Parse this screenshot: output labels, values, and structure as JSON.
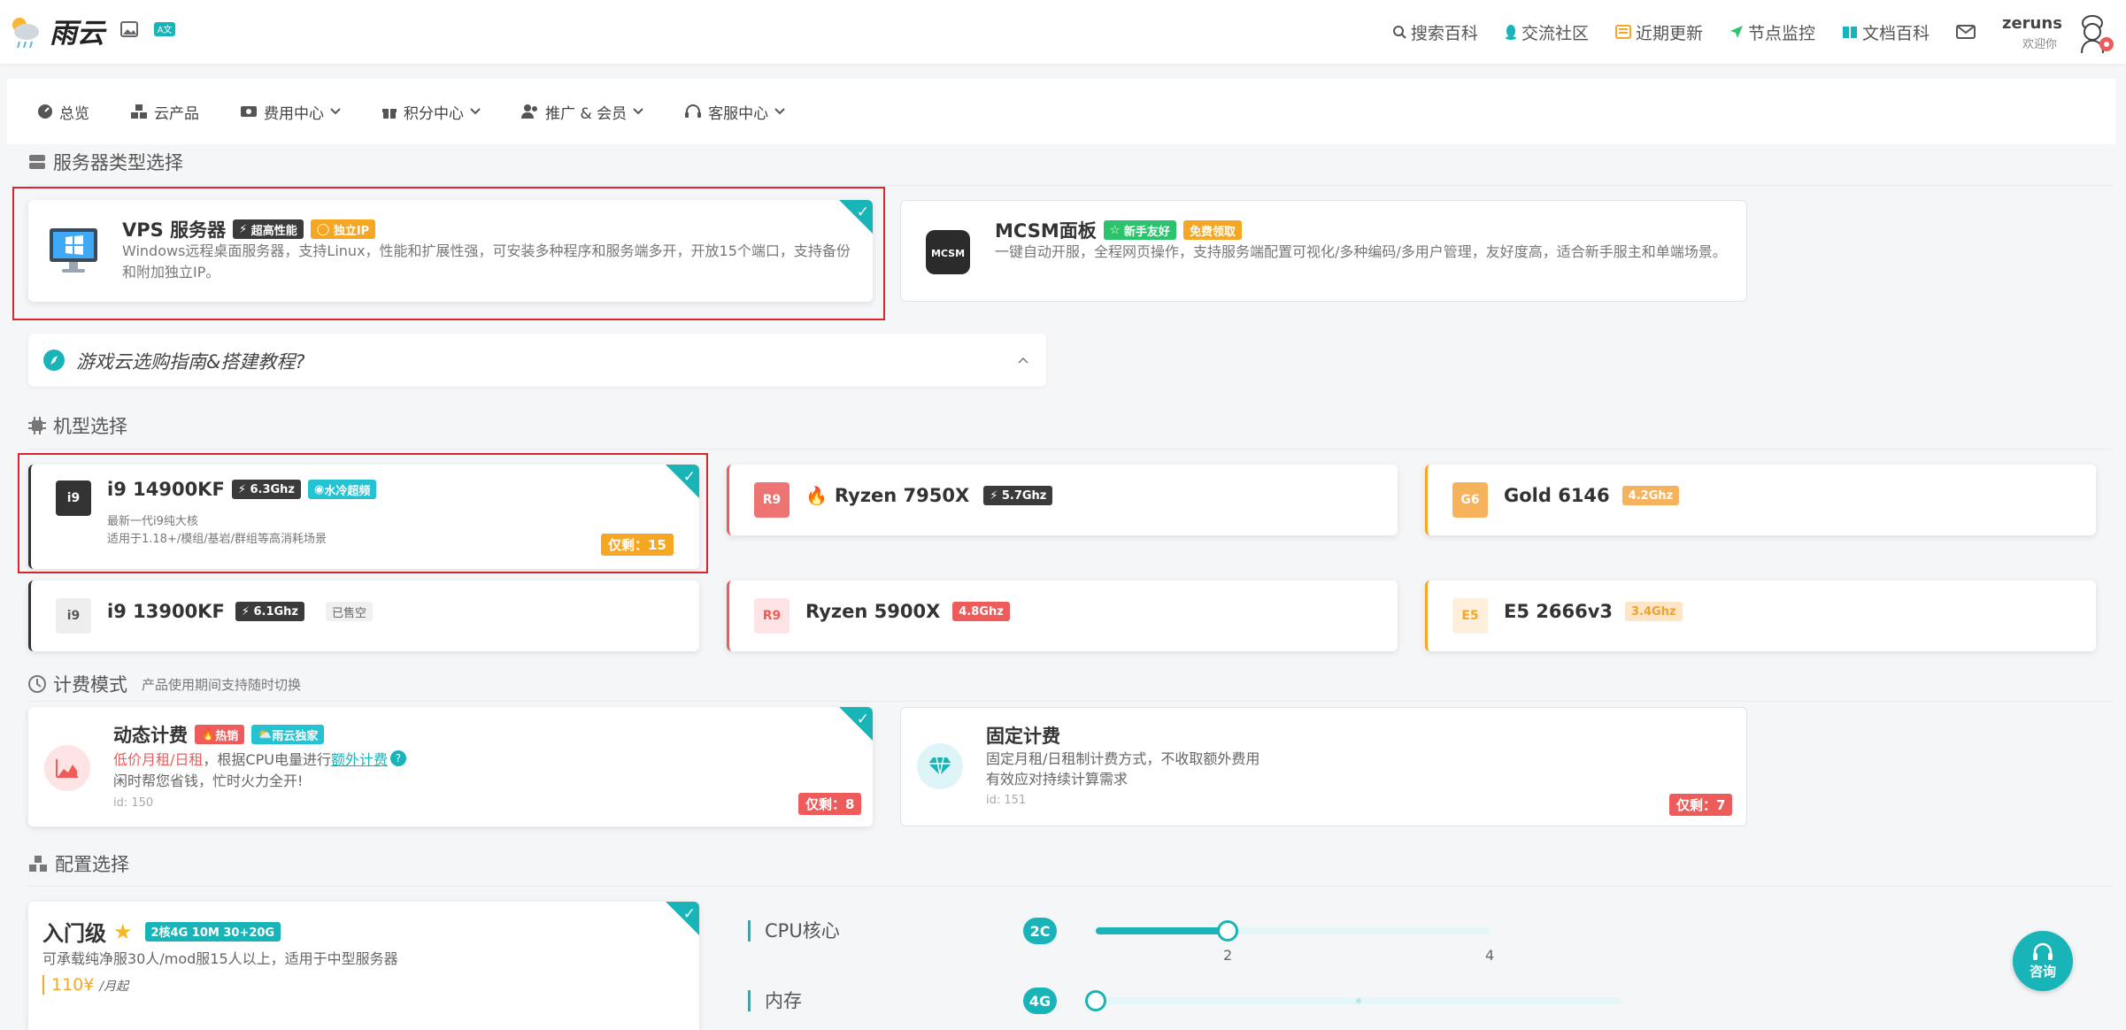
{
  "brand": {
    "name": "雨云"
  },
  "topnav": {
    "links": [
      {
        "label": "搜索百科",
        "icon": "search-icon"
      },
      {
        "label": "交流社区",
        "icon": "qq-icon"
      },
      {
        "label": "近期更新",
        "icon": "news-icon"
      },
      {
        "label": "节点监控",
        "icon": "location-arrow-icon"
      },
      {
        "label": "文档百科",
        "icon": "book-icon"
      }
    ],
    "mail_icon": "mail-icon",
    "user": {
      "name": "zeruns",
      "welcome": "欢迎你"
    }
  },
  "mainnav": {
    "items": [
      {
        "label": "总览",
        "icon": "dashboard-icon",
        "dropdown": false
      },
      {
        "label": "云产品",
        "icon": "cubes-icon",
        "dropdown": false
      },
      {
        "label": "费用中心",
        "icon": "money-icon",
        "dropdown": true
      },
      {
        "label": "积分中心",
        "icon": "gift-icon",
        "dropdown": true
      },
      {
        "label": "推广 & 会员",
        "icon": "users-icon",
        "dropdown": true
      },
      {
        "label": "客服中心",
        "icon": "headset-icon",
        "dropdown": true
      }
    ]
  },
  "server_type": {
    "section_title": "服务器类型选择",
    "options": [
      {
        "title": "VPS 服务器",
        "tags": [
          "超高性能",
          "独立IP"
        ],
        "desc": "Windows远程桌面服务器，支持Linux，性能和扩展性强，可安装多种程序和服务端多开，开放15个端口，支持备份和附加独立IP。",
        "selected": true
      },
      {
        "title": "MCSM面板",
        "tags": [
          "新手友好",
          "免费领取"
        ],
        "desc": "一键自动开服，全程网页操作，支持服务端配置可视化/多种编码/多用户管理，友好度高，适合新手服主和单端场景。",
        "selected": false
      }
    ],
    "guide": "游戏云选购指南&搭建教程?"
  },
  "machine": {
    "section_title": "机型选择",
    "options": [
      {
        "badge": "i9",
        "name": "i9 14900KF",
        "freq": "6.3Ghz",
        "extra_tag": "水冷超频",
        "line1": "最新一代i9纯大核",
        "line2": "适用于1.18+/模组/基岩/群组等高消耗场景",
        "stock": "仅剩：15",
        "selected": true
      },
      {
        "badge": "R9",
        "name": "Ryzen 7950X",
        "freq": "5.7Ghz"
      },
      {
        "badge": "G6",
        "name": "Gold 6146",
        "freq": "4.2Ghz"
      },
      {
        "badge": "i9",
        "name": "i9 13900KF",
        "freq": "6.1Ghz",
        "status": "已售空"
      },
      {
        "badge": "R9",
        "name": "Ryzen 5900X",
        "freq": "4.8Ghz"
      },
      {
        "badge": "E5",
        "name": "E5 2666v3",
        "freq": "3.4Ghz"
      }
    ]
  },
  "billing": {
    "section_title": "计费模式",
    "section_sub": "产品使用期间支持随时切换",
    "options": [
      {
        "title": "动态计费",
        "tags": [
          "热销",
          "雨云独家"
        ],
        "line1_red": "低价月租/日租",
        "line1_mid": "，根据CPU电量进行",
        "line1_link": "额外计费",
        "line2": "闲时帮您省钱，忙时火力全开!",
        "id": "id: 150",
        "stock": "仅剩：8",
        "selected": true
      },
      {
        "title": "固定计费",
        "line1": "固定月租/日租制计费方式，不收取额外费用",
        "line2": "有效应对持续计算需求",
        "id": "id: 151",
        "stock": "仅剩：7",
        "selected": false
      }
    ]
  },
  "config": {
    "section_title": "配置选择",
    "plan": {
      "title": "入门级",
      "tag": "2核4G 10M 30+20G",
      "desc": "可承载纯净服30人/mod服15人以上，适用于中型服务器",
      "price": "110¥",
      "price_unit": "/月起"
    },
    "cpu": {
      "label": "CPU核心",
      "value_pill": "2C",
      "current": 2,
      "min": 1,
      "max": 4,
      "ticks": [
        "2",
        "4"
      ]
    },
    "mem": {
      "label": "内存",
      "value_pill": "4G",
      "current": 4
    }
  },
  "float_button": {
    "label": "咨询"
  },
  "colors": {
    "accent": "#19b4b7",
    "highlight": "#d9252b",
    "price": "#f5a623",
    "red_tag": "#ee5b5b"
  }
}
